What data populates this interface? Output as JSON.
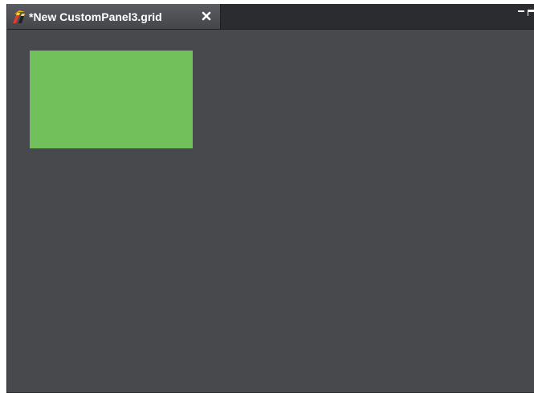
{
  "tab": {
    "title": "*New CustomPanel3.grid",
    "icon": "grid-editor-icon",
    "close_icon": "close-icon"
  },
  "window_controls": {
    "minimize_icon": "minimize-icon",
    "maximize_icon": "maximize-icon"
  },
  "canvas": {
    "background": "#48494d",
    "widgets": [
      {
        "type": "rectangle",
        "color": "#72c05b"
      }
    ]
  }
}
